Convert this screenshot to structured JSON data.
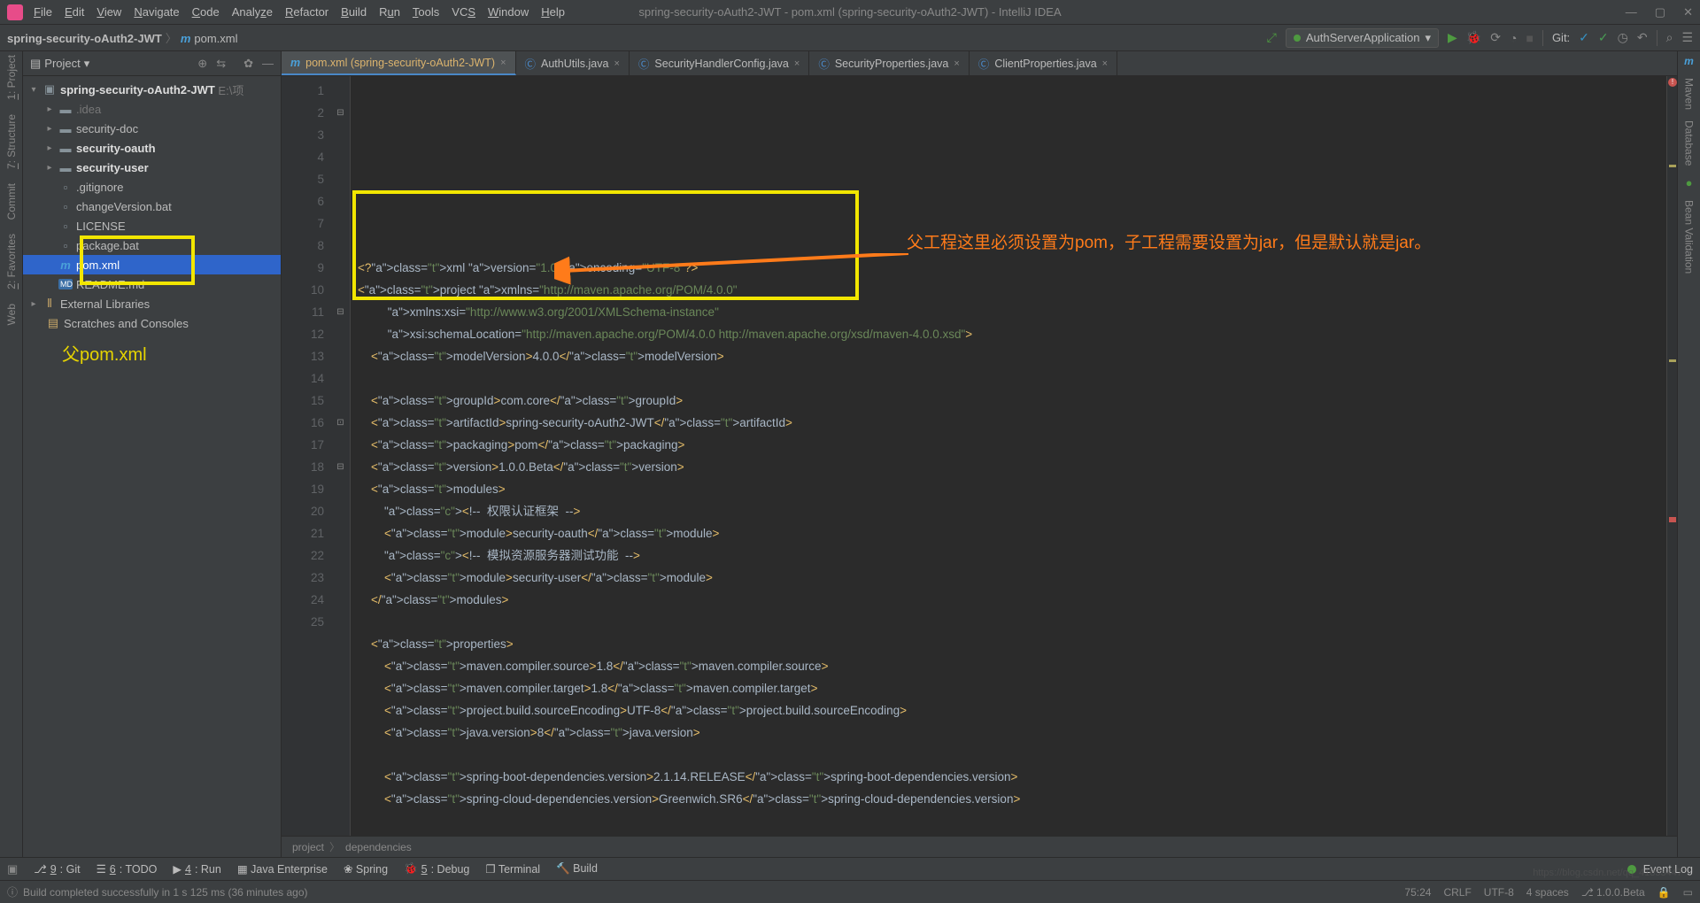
{
  "window": {
    "title": "spring-security-oAuth2-JWT - pom.xml (spring-security-oAuth2-JWT) - IntelliJ IDEA"
  },
  "menu": [
    "File",
    "Edit",
    "View",
    "Navigate",
    "Code",
    "Analyze",
    "Refactor",
    "Build",
    "Run",
    "Tools",
    "VCS",
    "Window",
    "Help"
  ],
  "crumb": {
    "root": "spring-security-oAuth2-JWT",
    "file": "pom.xml"
  },
  "runconfig": "AuthServerApplication",
  "git_label": "Git:",
  "project": {
    "header": "Project",
    "root": {
      "name": "spring-security-oAuth2-JWT",
      "hint": "E:\\项"
    },
    "items": [
      {
        "name": ".idea",
        "t": "folder",
        "d": 1,
        "exp": true,
        "gray": true
      },
      {
        "name": "security-doc",
        "t": "folder",
        "d": 1,
        "exp": true
      },
      {
        "name": "security-oauth",
        "t": "mod",
        "d": 1,
        "exp": true,
        "bold": true
      },
      {
        "name": "security-user",
        "t": "mod",
        "d": 1,
        "exp": true,
        "bold": true
      },
      {
        "name": ".gitignore",
        "t": "file",
        "d": 1
      },
      {
        "name": "changeVersion.bat",
        "t": "file",
        "d": 1
      },
      {
        "name": "LICENSE",
        "t": "file",
        "d": 1
      },
      {
        "name": "package.bat",
        "t": "file",
        "d": 1,
        "boxTop": true
      },
      {
        "name": "pom.xml",
        "t": "pom",
        "d": 1,
        "sel": true
      },
      {
        "name": "README.md",
        "t": "md",
        "d": 1,
        "boxBot": true
      }
    ],
    "ext": "External Libraries",
    "scratches": "Scratches and Consoles",
    "annot": "父pom.xml"
  },
  "tabs": [
    {
      "label": "pom.xml (spring-security-oAuth2-JWT)",
      "icon": "m",
      "active": true
    },
    {
      "label": "AuthUtils.java",
      "icon": "c"
    },
    {
      "label": "SecurityHandlerConfig.java",
      "icon": "c"
    },
    {
      "label": "SecurityProperties.java",
      "icon": "c"
    },
    {
      "label": "ClientProperties.java",
      "icon": "c"
    }
  ],
  "code": {
    "lines": [
      "<?xml version=\"1.0\" encoding=\"UTF-8\"?>",
      "<project xmlns=\"http://maven.apache.org/POM/4.0.0\"",
      "         xmlns:xsi=\"http://www.w3.org/2001/XMLSchema-instance\"",
      "         xsi:schemaLocation=\"http://maven.apache.org/POM/4.0.0 http://maven.apache.org/xsd/maven-4.0.0.xsd\">",
      "    <modelVersion>4.0.0</modelVersion>",
      "",
      "    <groupId>com.core</groupId>",
      "    <artifactId>spring-security-oAuth2-JWT</artifactId>",
      "    <packaging>pom</packaging>",
      "    <version>1.0.0.Beta</version>",
      "    <modules>",
      "        <!--  权限认证框架  -->",
      "        <module>security-oauth</module>",
      "        <!--  模拟资源服务器测试功能  -->",
      "        <module>security-user</module>",
      "    </modules>",
      "",
      "    <properties>",
      "        <maven.compiler.source>1.8</maven.compiler.source>",
      "        <maven.compiler.target>1.8</maven.compiler.target>",
      "        <project.build.sourceEncoding>UTF-8</project.build.sourceEncoding>",
      "        <java.version>8</java.version>",
      "",
      "        <spring-boot-dependencies.version>2.1.14.RELEASE</spring-boot-dependencies.version>",
      "        <spring-cloud-dependencies.version>Greenwich.SR6</spring-cloud-dependencies.version>"
    ]
  },
  "breadcrumbs": [
    "project",
    "dependencies"
  ],
  "annotation": {
    "text": "父工程这里必须设置为pom，子工程需要设置为jar，但是默认就是jar。"
  },
  "toolwindows": [
    {
      "k": "9",
      "l": "Git"
    },
    {
      "k": "6",
      "l": "TODO"
    },
    {
      "k": "4",
      "l": "Run"
    },
    {
      "l": "Java Enterprise"
    },
    {
      "l": "Spring"
    },
    {
      "k": "5",
      "l": "Debug"
    },
    {
      "l": "Terminal"
    },
    {
      "l": "Build"
    }
  ],
  "eventlog": "Event Log",
  "status": {
    "msg": "Build completed successfully in 1 s 125 ms (36 minutes ago)",
    "pos": "75:24",
    "eol": "CRLF",
    "enc": "UTF-8",
    "indent": "4 spaces",
    "ver": "1.0.0.Beta"
  },
  "watermark": "https://blog.csdn.net/qq_41853447"
}
